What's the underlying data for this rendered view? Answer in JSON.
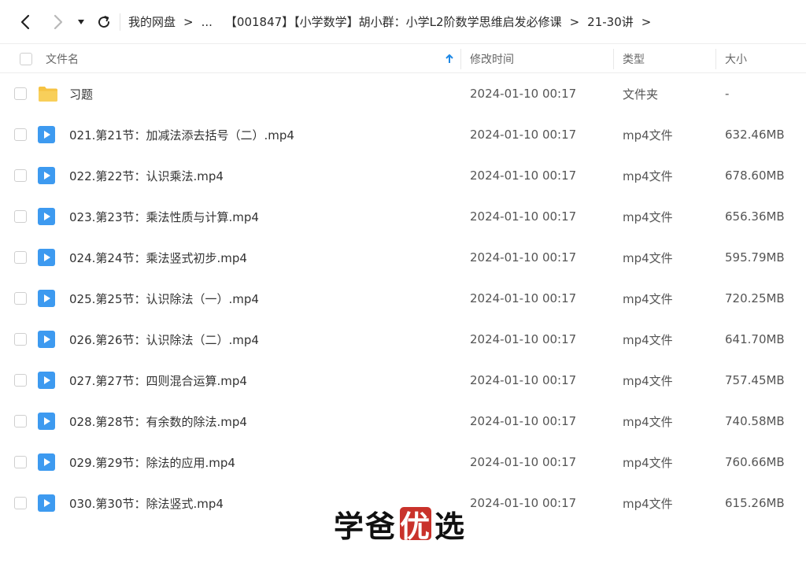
{
  "breadcrumb": {
    "items": [
      "我的网盘",
      "...",
      "【001847】【小学数学】胡小群：小学L2阶数学思维启发必修课",
      "21-30讲"
    ],
    "separator": ">"
  },
  "header": {
    "name": "文件名",
    "modified": "修改时间",
    "type": "类型",
    "size": "大小"
  },
  "files": [
    {
      "name": "习题",
      "modified": "2024-01-10 00:17",
      "type": "文件夹",
      "size": "-",
      "icon": "folder-icon"
    },
    {
      "name": "021.第21节：加减法添去括号（二）.mp4",
      "modified": "2024-01-10 00:17",
      "type": "mp4文件",
      "size": "632.46MB",
      "icon": "video-icon"
    },
    {
      "name": "022.第22节：认识乘法.mp4",
      "modified": "2024-01-10 00:17",
      "type": "mp4文件",
      "size": "678.60MB",
      "icon": "video-icon"
    },
    {
      "name": "023.第23节：乘法性质与计算.mp4",
      "modified": "2024-01-10 00:17",
      "type": "mp4文件",
      "size": "656.36MB",
      "icon": "video-icon"
    },
    {
      "name": "024.第24节：乘法竖式初步.mp4",
      "modified": "2024-01-10 00:17",
      "type": "mp4文件",
      "size": "595.79MB",
      "icon": "video-icon"
    },
    {
      "name": "025.第25节：认识除法（一）.mp4",
      "modified": "2024-01-10 00:17",
      "type": "mp4文件",
      "size": "720.25MB",
      "icon": "video-icon"
    },
    {
      "name": "026.第26节：认识除法（二）.mp4",
      "modified": "2024-01-10 00:17",
      "type": "mp4文件",
      "size": "641.70MB",
      "icon": "video-icon"
    },
    {
      "name": "027.第27节：四则混合运算.mp4",
      "modified": "2024-01-10 00:17",
      "type": "mp4文件",
      "size": "757.45MB",
      "icon": "video-icon"
    },
    {
      "name": "028.第28节：有余数的除法.mp4",
      "modified": "2024-01-10 00:17",
      "type": "mp4文件",
      "size": "740.58MB",
      "icon": "video-icon"
    },
    {
      "name": "029.第29节：除法的应用.mp4",
      "modified": "2024-01-10 00:17",
      "type": "mp4文件",
      "size": "760.66MB",
      "icon": "video-icon"
    },
    {
      "name": "030.第30节：除法竖式.mp4",
      "modified": "2024-01-10 00:17",
      "type": "mp4文件",
      "size": "615.26MB",
      "icon": "video-icon"
    }
  ],
  "watermark": {
    "chars": [
      "学",
      "爸",
      "优",
      "选"
    ]
  },
  "colors": {
    "accent": "#1e88e5",
    "video_icon": "#3d9af0",
    "folder": "#f6c343",
    "watermark_red": "#c9322b"
  }
}
